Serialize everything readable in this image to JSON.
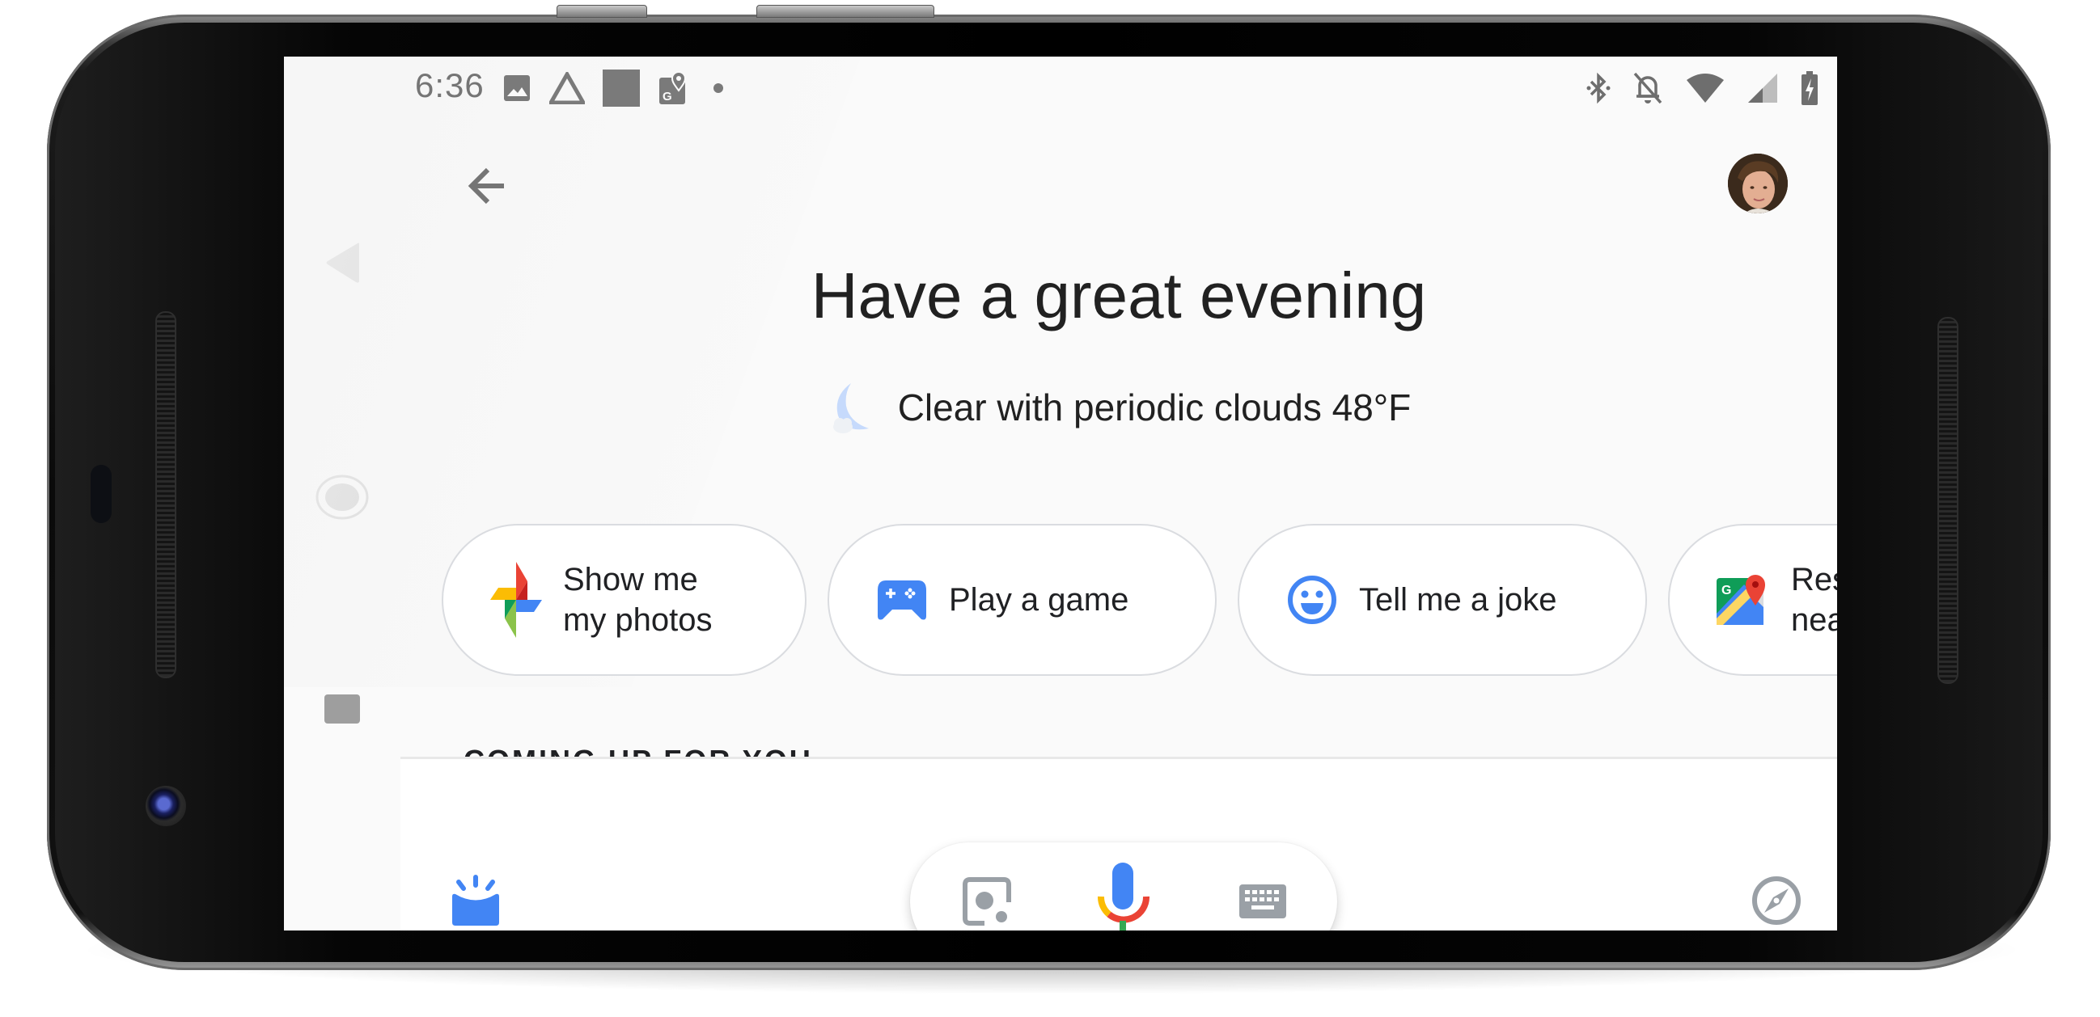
{
  "device": {
    "model_frame": "phone-landscape"
  },
  "status_bar": {
    "time": "6:36",
    "left_icons": [
      "image-notification-icon",
      "drive-icon",
      "blank-notification-icon",
      "maps-notification-icon",
      "more-notifications-dot-icon"
    ],
    "right_icons": [
      "bluetooth-icon",
      "notifications-off-icon",
      "wifi-icon",
      "cell-signal-icon",
      "battery-charging-icon"
    ]
  },
  "nav_bar": {
    "back": "back-nav-icon",
    "home": "home-nav-icon",
    "recents": "recents-nav-icon"
  },
  "header": {
    "back_icon": "arrow-back-icon",
    "avatar_label": "account-avatar"
  },
  "greeting": {
    "title": "Have a great evening",
    "weather_icon": "moon-cloud-icon",
    "weather_text": "Clear with periodic clouds 48°F"
  },
  "suggestions": [
    {
      "label": "Show me\nmy photos",
      "icon": "google-photos-icon"
    },
    {
      "label": "Play a game",
      "icon": "gamepad-icon"
    },
    {
      "label": "Tell me a joke",
      "icon": "smiley-icon"
    },
    {
      "label": "Restaurants\nnearby",
      "icon": "google-maps-icon"
    }
  ],
  "section": {
    "title": "COMING UP FOR YOU"
  },
  "bottom_bar": {
    "left_icon": "snapshot-icon",
    "lens_icon": "lens-icon",
    "mic_icon": "mic-icon",
    "keyboard_icon": "keyboard-icon",
    "right_icon": "explore-compass-icon"
  },
  "colors": {
    "accent_blue": "#4285f4",
    "google_red": "#ea4335",
    "google_yellow": "#fbbc04",
    "google_green": "#34a853",
    "icon_gray": "#9aa0a6",
    "status_gray": "#757575",
    "text_dark": "#212121"
  }
}
